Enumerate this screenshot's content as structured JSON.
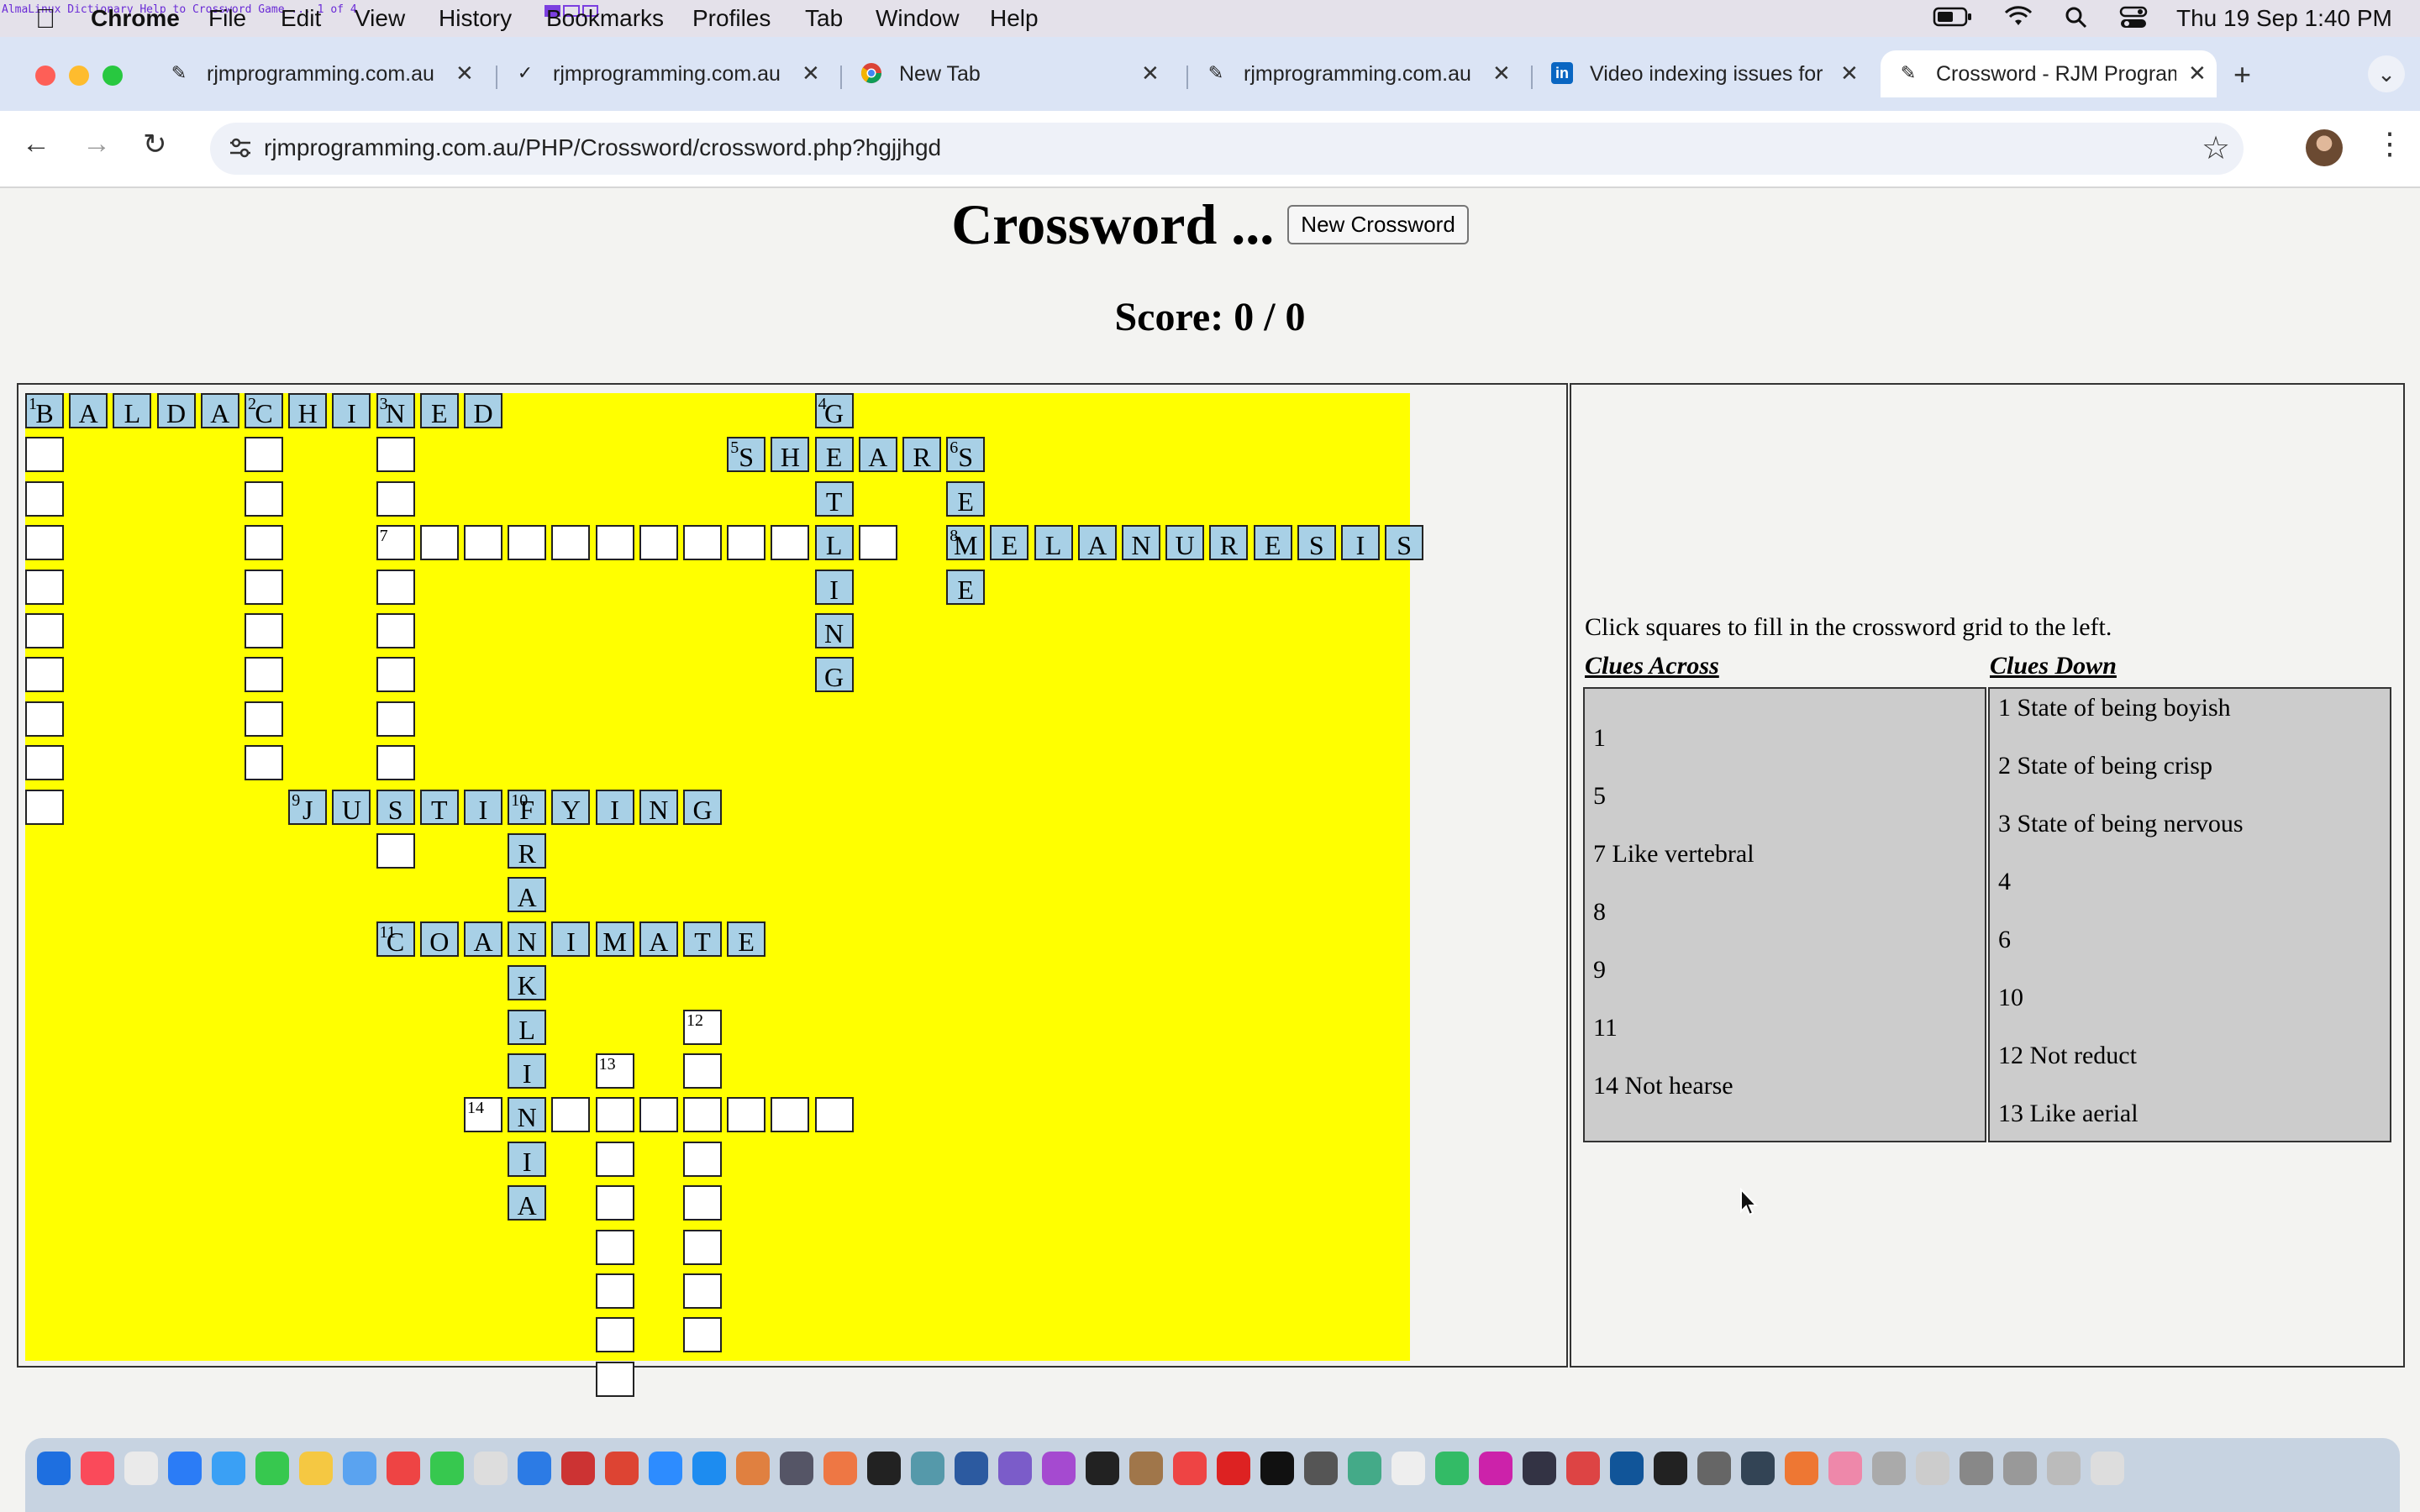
{
  "menubar": {
    "top_strip_text": "AlmaLinux Dictionary Help to Crossword Game ... 1 of 4",
    "progress": [
      1,
      0,
      0
    ],
    "app_name": "Chrome",
    "items": [
      "File",
      "Edit",
      "View",
      "History",
      "Bookmarks",
      "Profiles",
      "Tab",
      "Window",
      "Help"
    ],
    "clock": "Thu 19 Sep  1:40 PM"
  },
  "tabs": [
    {
      "title": "rjmprogramming.com.au",
      "icon": "rjm-icon"
    },
    {
      "title": "rjmprogramming.com.au",
      "icon": "checkmark-icon"
    },
    {
      "title": "New Tab",
      "icon": "chrome-icon"
    },
    {
      "title": "rjmprogramming.com.au",
      "icon": "rjm-icon"
    },
    {
      "title": "Video indexing issues for",
      "icon": "linkedin-icon"
    },
    {
      "title": "Crossword - RJM Programming",
      "icon": "rjm-icon",
      "active": true
    }
  ],
  "toolbar": {
    "url": "rjmprogramming.com.au/PHP/Crossword/crossword.php?hgjjhgd"
  },
  "page": {
    "title": "Crossword ...",
    "new_button": "New Crossword",
    "score": "Score: 0 / 0",
    "instructions": "Click squares to fill in the crossword grid to the left.",
    "across_heading": "Clues Across",
    "down_heading": "Clues Down",
    "clues_across": [
      "1",
      "5",
      "7 Like vertebral",
      "8",
      "9",
      "11",
      "14 Not hearse"
    ],
    "clues_down": [
      "1 State of being boyish",
      "2 State of being crisp",
      "3 State of being nervous",
      "4",
      "6",
      "10",
      "12 Not reduct",
      "13 Like aerial"
    ]
  },
  "grid": {
    "cells": [
      {
        "r": 0,
        "c": 0,
        "l": "B",
        "n": "1"
      },
      {
        "r": 0,
        "c": 1,
        "l": "A"
      },
      {
        "r": 0,
        "c": 2,
        "l": "L"
      },
      {
        "r": 0,
        "c": 3,
        "l": "D"
      },
      {
        "r": 0,
        "c": 4,
        "l": "A"
      },
      {
        "r": 0,
        "c": 5,
        "l": "C",
        "n": "2"
      },
      {
        "r": 0,
        "c": 6,
        "l": "H"
      },
      {
        "r": 0,
        "c": 7,
        "l": "I"
      },
      {
        "r": 0,
        "c": 8,
        "l": "N",
        "n": "3"
      },
      {
        "r": 0,
        "c": 9,
        "l": "E"
      },
      {
        "r": 0,
        "c": 10,
        "l": "D"
      },
      {
        "r": 0,
        "c": 18,
        "l": "G",
        "n": "4"
      },
      {
        "r": 1,
        "c": 0
      },
      {
        "r": 1,
        "c": 5
      },
      {
        "r": 1,
        "c": 8
      },
      {
        "r": 1,
        "c": 16,
        "l": "S",
        "n": "5"
      },
      {
        "r": 1,
        "c": 17,
        "l": "H"
      },
      {
        "r": 1,
        "c": 18,
        "l": "E"
      },
      {
        "r": 1,
        "c": 19,
        "l": "A"
      },
      {
        "r": 1,
        "c": 20,
        "l": "R"
      },
      {
        "r": 1,
        "c": 21,
        "l": "S",
        "n": "6"
      },
      {
        "r": 2,
        "c": 0
      },
      {
        "r": 2,
        "c": 5
      },
      {
        "r": 2,
        "c": 8
      },
      {
        "r": 2,
        "c": 18,
        "l": "T"
      },
      {
        "r": 2,
        "c": 21,
        "l": "E"
      },
      {
        "r": 3,
        "c": 0
      },
      {
        "r": 3,
        "c": 5
      },
      {
        "r": 3,
        "c": 8,
        "n": "7"
      },
      {
        "r": 3,
        "c": 9
      },
      {
        "r": 3,
        "c": 10
      },
      {
        "r": 3,
        "c": 11
      },
      {
        "r": 3,
        "c": 12
      },
      {
        "r": 3,
        "c": 13
      },
      {
        "r": 3,
        "c": 14
      },
      {
        "r": 3,
        "c": 15
      },
      {
        "r": 3,
        "c": 16
      },
      {
        "r": 3,
        "c": 17
      },
      {
        "r": 3,
        "c": 18,
        "l": "L"
      },
      {
        "r": 3,
        "c": 19
      },
      {
        "r": 3,
        "c": 21,
        "l": "M",
        "n": "8"
      },
      {
        "r": 3,
        "c": 22,
        "l": "E"
      },
      {
        "r": 3,
        "c": 23,
        "l": "L"
      },
      {
        "r": 3,
        "c": 24,
        "l": "A"
      },
      {
        "r": 3,
        "c": 25,
        "l": "N"
      },
      {
        "r": 3,
        "c": 26,
        "l": "U"
      },
      {
        "r": 3,
        "c": 27,
        "l": "R"
      },
      {
        "r": 3,
        "c": 28,
        "l": "E"
      },
      {
        "r": 3,
        "c": 29,
        "l": "S"
      },
      {
        "r": 3,
        "c": 30,
        "l": "I"
      },
      {
        "r": 3,
        "c": 31,
        "l": "S"
      },
      {
        "r": 4,
        "c": 0
      },
      {
        "r": 4,
        "c": 5
      },
      {
        "r": 4,
        "c": 8
      },
      {
        "r": 4,
        "c": 18,
        "l": "I"
      },
      {
        "r": 4,
        "c": 21,
        "l": "E"
      },
      {
        "r": 5,
        "c": 0
      },
      {
        "r": 5,
        "c": 5
      },
      {
        "r": 5,
        "c": 8
      },
      {
        "r": 5,
        "c": 18,
        "l": "N"
      },
      {
        "r": 6,
        "c": 0
      },
      {
        "r": 6,
        "c": 5
      },
      {
        "r": 6,
        "c": 8
      },
      {
        "r": 6,
        "c": 18,
        "l": "G"
      },
      {
        "r": 7,
        "c": 0
      },
      {
        "r": 7,
        "c": 5
      },
      {
        "r": 7,
        "c": 8
      },
      {
        "r": 8,
        "c": 0
      },
      {
        "r": 8,
        "c": 5
      },
      {
        "r": 8,
        "c": 8
      },
      {
        "r": 9,
        "c": 0
      },
      {
        "r": 9,
        "c": 6,
        "l": "J",
        "n": "9"
      },
      {
        "r": 9,
        "c": 7,
        "l": "U"
      },
      {
        "r": 9,
        "c": 8,
        "l": "S"
      },
      {
        "r": 9,
        "c": 9,
        "l": "T"
      },
      {
        "r": 9,
        "c": 10,
        "l": "I"
      },
      {
        "r": 9,
        "c": 11,
        "l": "F",
        "n": "10"
      },
      {
        "r": 9,
        "c": 12,
        "l": "Y"
      },
      {
        "r": 9,
        "c": 13,
        "l": "I"
      },
      {
        "r": 9,
        "c": 14,
        "l": "N"
      },
      {
        "r": 9,
        "c": 15,
        "l": "G"
      },
      {
        "r": 10,
        "c": 8
      },
      {
        "r": 10,
        "c": 11,
        "l": "R"
      },
      {
        "r": 11,
        "c": 11,
        "l": "A"
      },
      {
        "r": 12,
        "c": 8,
        "l": "C",
        "n": "11"
      },
      {
        "r": 12,
        "c": 9,
        "l": "O"
      },
      {
        "r": 12,
        "c": 10,
        "l": "A"
      },
      {
        "r": 12,
        "c": 11,
        "l": "N"
      },
      {
        "r": 12,
        "c": 12,
        "l": "I"
      },
      {
        "r": 12,
        "c": 13,
        "l": "M"
      },
      {
        "r": 12,
        "c": 14,
        "l": "A"
      },
      {
        "r": 12,
        "c": 15,
        "l": "T"
      },
      {
        "r": 12,
        "c": 16,
        "l": "E"
      },
      {
        "r": 13,
        "c": 11,
        "l": "K"
      },
      {
        "r": 14,
        "c": 11,
        "l": "L"
      },
      {
        "r": 14,
        "c": 15,
        "n": "12"
      },
      {
        "r": 15,
        "c": 11,
        "l": "I"
      },
      {
        "r": 15,
        "c": 13,
        "n": "13"
      },
      {
        "r": 15,
        "c": 15
      },
      {
        "r": 16,
        "c": 10,
        "n": "14"
      },
      {
        "r": 16,
        "c": 11,
        "l": "N"
      },
      {
        "r": 16,
        "c": 12
      },
      {
        "r": 16,
        "c": 13
      },
      {
        "r": 16,
        "c": 14
      },
      {
        "r": 16,
        "c": 15
      },
      {
        "r": 16,
        "c": 16
      },
      {
        "r": 16,
        "c": 17
      },
      {
        "r": 16,
        "c": 18
      },
      {
        "r": 17,
        "c": 11,
        "l": "I"
      },
      {
        "r": 17,
        "c": 13
      },
      {
        "r": 17,
        "c": 15
      },
      {
        "r": 18,
        "c": 11,
        "l": "A"
      },
      {
        "r": 18,
        "c": 13
      },
      {
        "r": 18,
        "c": 15
      },
      {
        "r": 19,
        "c": 13
      },
      {
        "r": 19,
        "c": 15
      },
      {
        "r": 20,
        "c": 13
      },
      {
        "r": 20,
        "c": 15
      },
      {
        "r": 21,
        "c": 13
      },
      {
        "r": 21,
        "c": 15
      },
      {
        "r": 22,
        "c": 13
      }
    ]
  },
  "colors": {
    "grid_background": "#ffff00",
    "answer_cell": "#a8d0e6",
    "empty_cell": "#ffffff",
    "clue_box": "#cccccc"
  }
}
